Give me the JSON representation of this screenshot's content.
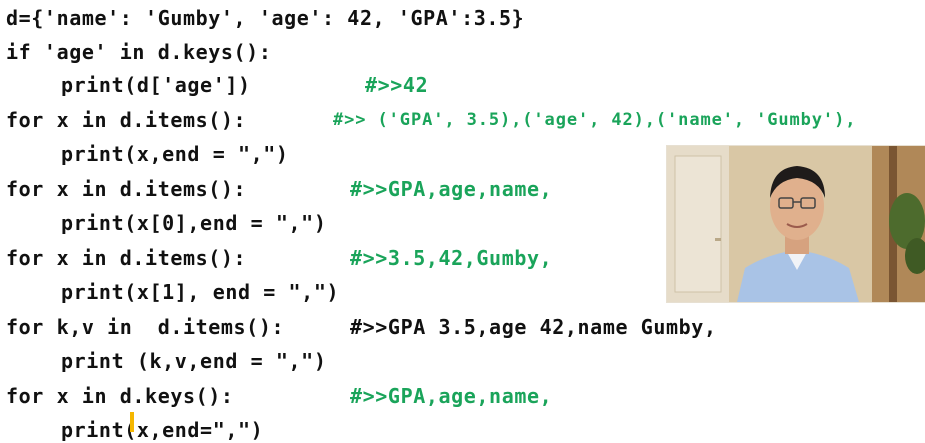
{
  "code": {
    "line1": "d={'name': 'Gumby', 'age': 42, 'GPA':3.5}",
    "line2": "if 'age' in d.keys():",
    "line3": "print(d['age'])",
    "line3_comment": "#>>42",
    "line4": "for x in d.items():",
    "line4_comment": "#>> ('GPA', 3.5),('age', 42),('name', 'Gumby'),",
    "line5": "print(x,end = \",\")",
    "line6": "for x in d.items():",
    "line6_comment": "#>>GPA,age,name,",
    "line7": "print(x[0],end = \",\")",
    "line8": "for x in d.items():",
    "line8_comment": "#>>3.5,42,Gumby,",
    "line9": "print(x[1], end = \",\")",
    "line10": "for k,v in  d.items():",
    "line10_comment": "#>>GPA 3.5,age 42,name Gumby,",
    "line11": "print (k,v,end = \",\")",
    "line12": "for x in d.keys():",
    "line12_comment": "#>>GPA,age,name,",
    "line13": "print(x,end=\",\")"
  },
  "colors": {
    "code_text": "#111111",
    "comment_text": "#1aa45a",
    "cursor": "#f5b700"
  }
}
